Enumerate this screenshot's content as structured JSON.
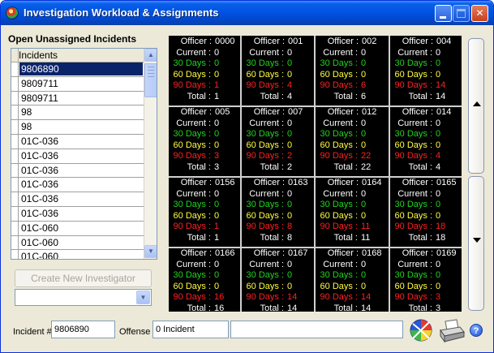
{
  "window": {
    "title": "Investigation Workload & Assignments"
  },
  "left": {
    "heading": "Open Unassigned Incidents",
    "column_header": "Incidents",
    "incidents": [
      "9806890",
      "9809711",
      "9809711",
      "98",
      "98",
      "01C-036",
      "01C-036",
      "01C-036",
      "01C-036",
      "01C-036",
      "01C-036",
      "01C-060",
      "01C-060",
      "01C-060"
    ],
    "selected_index": 0,
    "create_button": "Create New Investigator",
    "combo_value": ""
  },
  "labels": {
    "officer": "Officer :",
    "current": "Current :",
    "d30": "30 Days :",
    "d60": "60 Days :",
    "d90": "90 Days :",
    "total": "Total :"
  },
  "officers": [
    {
      "id": "0000",
      "current": "0",
      "d30": "0",
      "d60": "0",
      "d90": "1",
      "total": "1"
    },
    {
      "id": "001",
      "current": "0",
      "d30": "0",
      "d60": "0",
      "d90": "4",
      "total": "4"
    },
    {
      "id": "002",
      "current": "0",
      "d30": "0",
      "d60": "0",
      "d90": "6",
      "total": "6"
    },
    {
      "id": "004",
      "current": "0",
      "d30": "0",
      "d60": "0",
      "d90": "14",
      "total": "14"
    },
    {
      "id": "005",
      "current": "0",
      "d30": "0",
      "d60": "0",
      "d90": "3",
      "total": "3"
    },
    {
      "id": "007",
      "current": "0",
      "d30": "0",
      "d60": "0",
      "d90": "2",
      "total": "2"
    },
    {
      "id": "012",
      "current": "0",
      "d30": "0",
      "d60": "0",
      "d90": "22",
      "total": "22"
    },
    {
      "id": "014",
      "current": "0",
      "d30": "0",
      "d60": "0",
      "d90": "4",
      "total": "4"
    },
    {
      "id": "0156",
      "current": "0",
      "d30": "0",
      "d60": "0",
      "d90": "1",
      "total": "1"
    },
    {
      "id": "0163",
      "current": "0",
      "d30": "0",
      "d60": "0",
      "d90": "8",
      "total": "8"
    },
    {
      "id": "0164",
      "current": "0",
      "d30": "0",
      "d60": "0",
      "d90": "11",
      "total": "11"
    },
    {
      "id": "0165",
      "current": "0",
      "d30": "0",
      "d60": "0",
      "d90": "18",
      "total": "18"
    },
    {
      "id": "0166",
      "current": "0",
      "d30": "0",
      "d60": "0",
      "d90": "16",
      "total": "16"
    },
    {
      "id": "0167",
      "current": "0",
      "d30": "0",
      "d60": "0",
      "d90": "14",
      "total": "14"
    },
    {
      "id": "0168",
      "current": "0",
      "d30": "0",
      "d60": "0",
      "d90": "14",
      "total": "14"
    },
    {
      "id": "0169",
      "current": "0",
      "d30": "0",
      "d60": "0",
      "d90": "3",
      "total": "3"
    }
  ],
  "footer": {
    "incident_label": "Incident #",
    "incident_value": "9806890",
    "offense_label": "Offense",
    "offense_value": "0 Incident",
    "extra_value": ""
  },
  "icons": {
    "app": "app-globe-icon",
    "ball": "color-ball-icon",
    "print": "printer-icon",
    "help": "help-icon"
  },
  "colors": {
    "current": "#ffffff",
    "d30": "#21d421",
    "d60": "#ffff40",
    "d90": "#ff2020",
    "total": "#ffffff"
  }
}
